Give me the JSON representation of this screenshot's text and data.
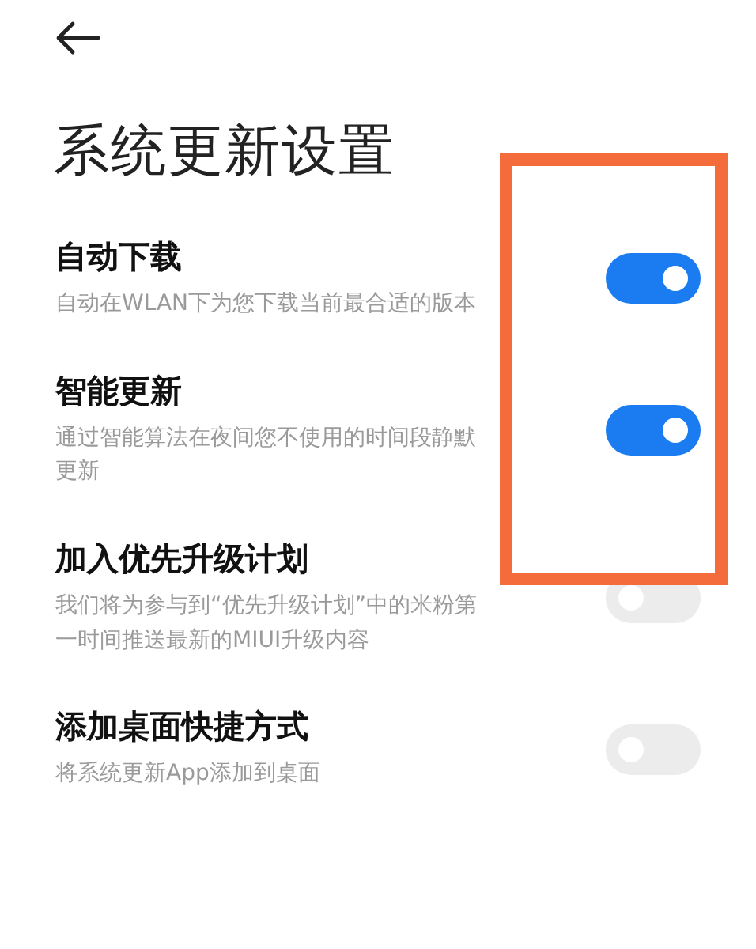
{
  "header": {
    "title": "系统更新设置"
  },
  "settings": [
    {
      "title": "自动下载",
      "description": "自动在WLAN下为您下载当前最合适的版本",
      "on": true
    },
    {
      "title": "智能更新",
      "description": "通过智能算法在夜间您不使用的时间段静默更新",
      "on": true
    },
    {
      "title": "加入优先升级计划",
      "description": "我们将为参与到“优先升级计划”中的米粉第一时间推送最新的MIUI升级内容",
      "on": false
    },
    {
      "title": "添加桌面快捷方式",
      "description": "将系统更新App添加到桌面",
      "on": false
    }
  ]
}
